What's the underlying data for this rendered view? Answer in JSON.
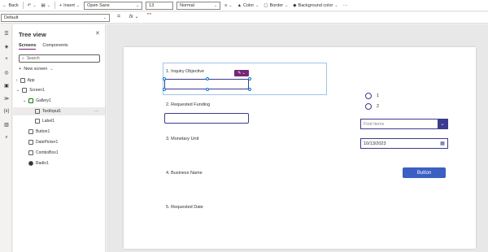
{
  "toolbar": {
    "back": "Back",
    "insert": "Insert",
    "font": "Open Sans",
    "size": "13",
    "weight": "Normal",
    "color": "Color",
    "border": "Border",
    "bg_color": "Background color",
    "more": "···"
  },
  "formula": {
    "property": "Default",
    "eq": "=",
    "fx": "fx",
    "value": "\"\""
  },
  "tree": {
    "title": "Tree view",
    "close": "✕",
    "tabs": [
      "Screens",
      "Components"
    ],
    "search_placeholder": "Search",
    "new_screen": "New screen",
    "nodes": {
      "app": "App",
      "screen1": "Screen1",
      "gallery1": "Gallery1",
      "textinput1": "TextInput1",
      "label1": "Label1",
      "button1": "Button1",
      "datepicker1": "DatePicker1",
      "combobox1": "ComboBox1",
      "radio1": "Radio1"
    },
    "more": "···"
  },
  "canvas": {
    "labels": {
      "q1": "1. Inquiry Objective",
      "q2": "2. Requested Funding",
      "q3": "3. Monetary Unit",
      "q4": "4. Business Name",
      "q5": "5. Requested Date"
    },
    "radio_options": [
      "1",
      "2"
    ],
    "combo_placeholder": "Find items",
    "date_value": "10/13/2023",
    "button_label": "Button"
  },
  "colors": {
    "accent": "#742774",
    "control": "#3b3b8f",
    "button": "#3b5fc2"
  }
}
